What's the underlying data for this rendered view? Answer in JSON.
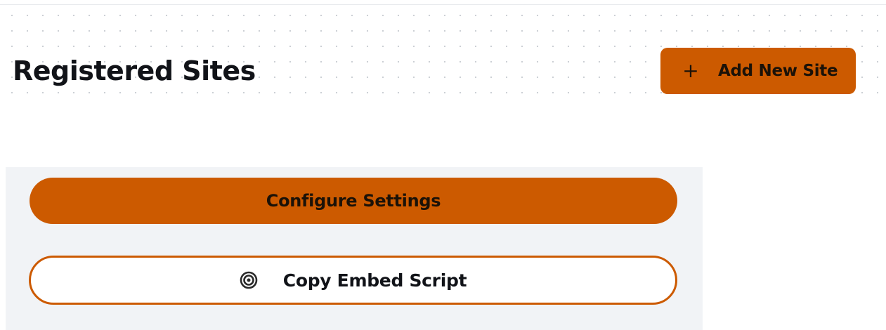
{
  "header": {
    "title": "Registered Sites",
    "add_button": {
      "icon": "plus-icon",
      "label": "Add New Site"
    }
  },
  "site_card": {
    "configure_button": {
      "label": "Configure Settings"
    },
    "copy_button": {
      "icon": "target-icon",
      "label": "Copy Embed Script"
    }
  },
  "colors": {
    "accent": "#cc5a00",
    "card_background": "#f1f3f6",
    "text": "#111318"
  }
}
